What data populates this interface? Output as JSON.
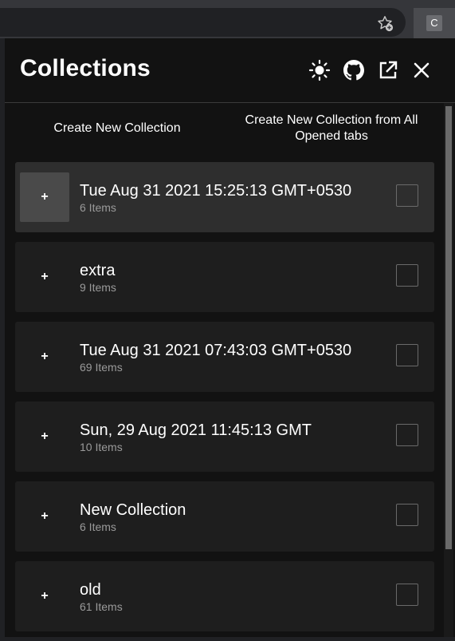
{
  "browser": {
    "bookmark_icon": "star-add-icon",
    "extension_label": "C"
  },
  "header": {
    "title": "Collections",
    "icons": [
      "sun-icon",
      "github-icon",
      "open-external-icon",
      "close-icon"
    ]
  },
  "actions": {
    "create_new": "Create New Collection",
    "create_from_tabs": "Create New Collection from All Opened tabs"
  },
  "collections": [
    {
      "name": "Tue Aug 31 2021 15:25:13 GMT+0530",
      "count": "6 Items",
      "plus": "+"
    },
    {
      "name": "extra",
      "count": "9 Items",
      "plus": "+"
    },
    {
      "name": "Tue Aug 31 2021 07:43:03 GMT+0530",
      "count": "69 Items",
      "plus": "+"
    },
    {
      "name": "Sun, 29 Aug 2021 11:45:13 GMT",
      "count": "10 Items",
      "plus": "+"
    },
    {
      "name": "New Collection",
      "count": "6 Items",
      "plus": "+"
    },
    {
      "name": "old",
      "count": "61 Items",
      "plus": "+"
    }
  ],
  "colors": {
    "panel_bg": "#121212",
    "item_bg": "#1e1e1e",
    "item_active_bg": "#2e2e2e",
    "muted_text": "#9a9a9a"
  }
}
